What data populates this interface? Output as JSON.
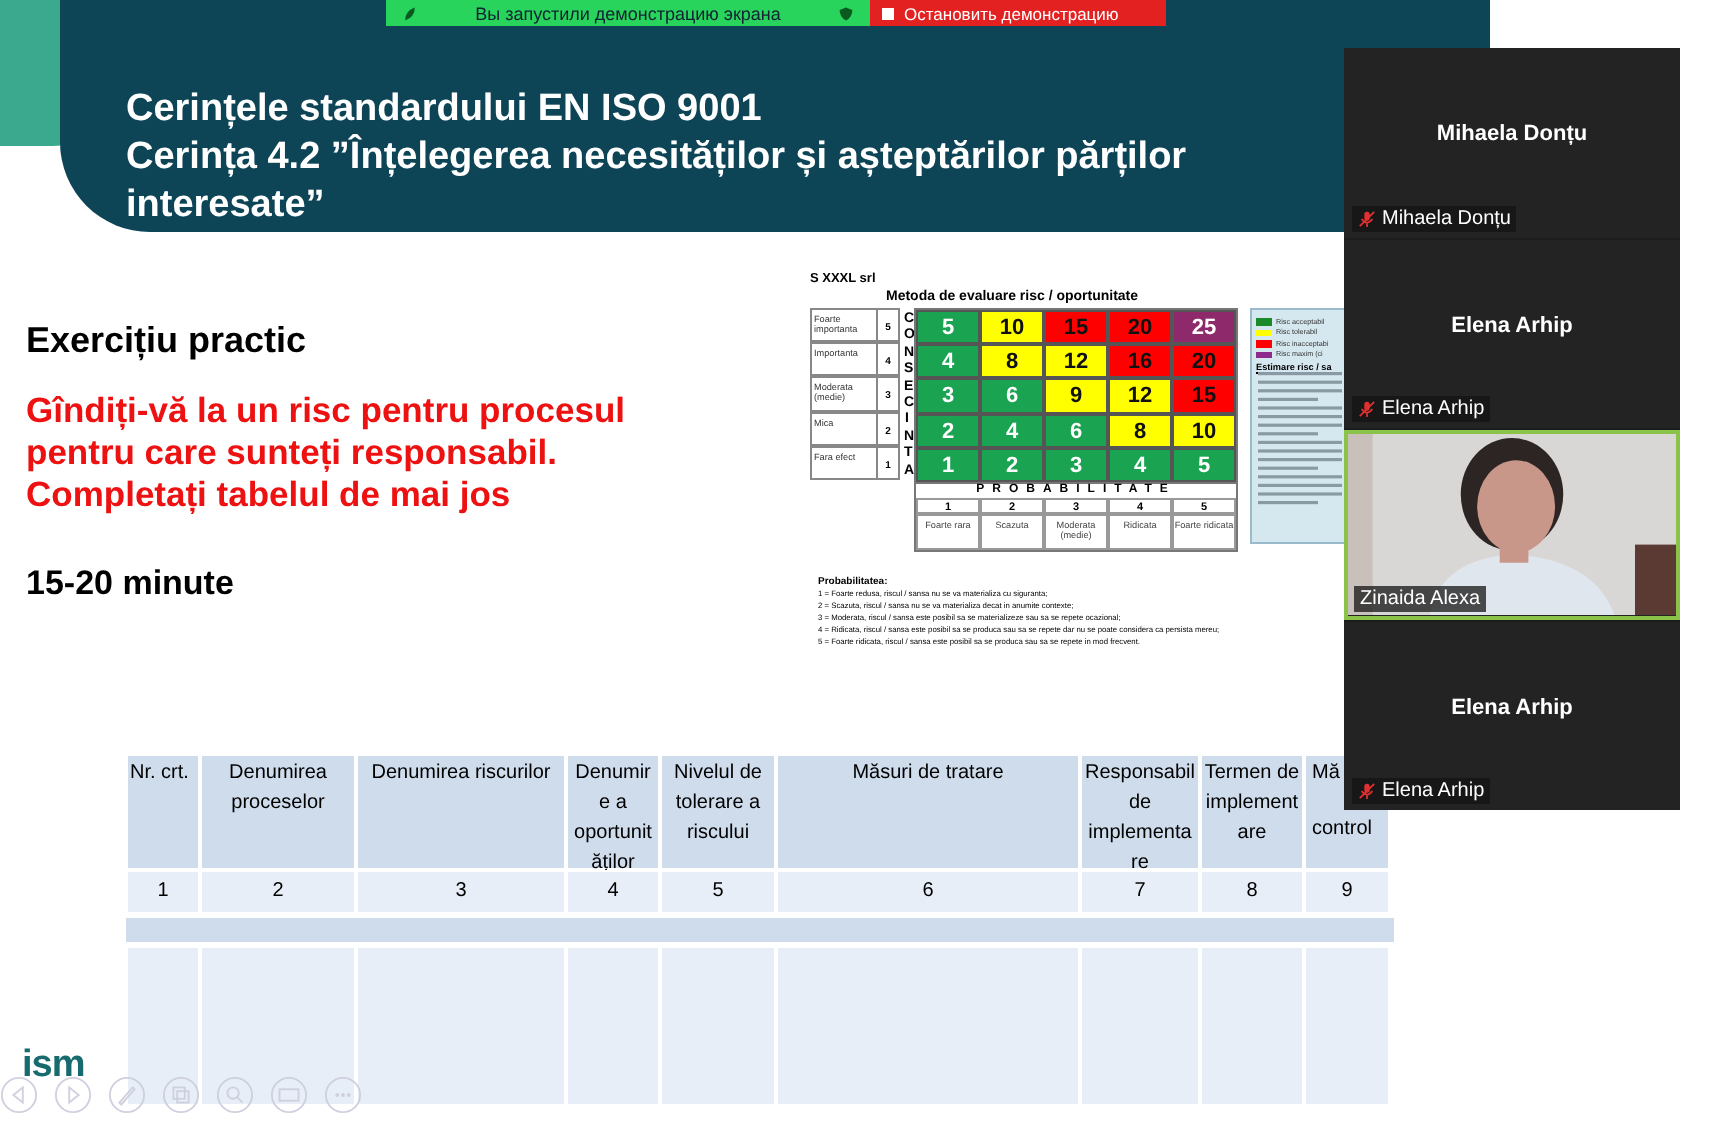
{
  "screen_share_bar": {
    "notice": "Вы запустили демонстрацию экрана",
    "stop_button": "Остановить демонстрацию"
  },
  "slide": {
    "title_lines": [
      "Cerințele standardului EN ISO 9001",
      "Cerința 4.2 ”Înțelegerea necesităților și așteptărilor părților interesate”"
    ],
    "exercise_heading": "Exercițiu practic",
    "instruction_lines": [
      "Gîndiți-vă la un risc pentru procesul",
      "pentru care sunteți responsabil.",
      "Completați tabelul de mai jos"
    ],
    "duration": "15-20 minute",
    "logo": "ism"
  },
  "risk_matrix": {
    "company": "S XXXL srl",
    "title": "Metoda de evaluare risc / oportunitate",
    "consequence_label": "CONSECINTA",
    "probability_label": "PROBABILITATE",
    "rows": [
      {
        "label": "Foarte importanta",
        "score": "5",
        "cells": [
          {
            "value": "5",
            "color": "#1aa350"
          },
          {
            "value": "10",
            "color": "#ffff00"
          },
          {
            "value": "15",
            "color": "#ff0000"
          },
          {
            "value": "20",
            "color": "#ff0000"
          },
          {
            "value": "25",
            "color": "#8e2a6b"
          }
        ]
      },
      {
        "label": "Importanta",
        "score": "4",
        "cells": [
          {
            "value": "4",
            "color": "#1aa350"
          },
          {
            "value": "8",
            "color": "#ffff00"
          },
          {
            "value": "12",
            "color": "#ffff00"
          },
          {
            "value": "16",
            "color": "#ff0000"
          },
          {
            "value": "20",
            "color": "#ff0000"
          }
        ]
      },
      {
        "label": "Moderata (medie)",
        "score": "3",
        "cells": [
          {
            "value": "3",
            "color": "#1aa350"
          },
          {
            "value": "6",
            "color": "#1aa350"
          },
          {
            "value": "9",
            "color": "#ffff00"
          },
          {
            "value": "12",
            "color": "#ffff00"
          },
          {
            "value": "15",
            "color": "#ff0000"
          }
        ]
      },
      {
        "label": "Mica",
        "score": "2",
        "cells": [
          {
            "value": "2",
            "color": "#1aa350"
          },
          {
            "value": "4",
            "color": "#1aa350"
          },
          {
            "value": "6",
            "color": "#1aa350"
          },
          {
            "value": "8",
            "color": "#ffff00"
          },
          {
            "value": "10",
            "color": "#ffff00"
          }
        ]
      },
      {
        "label": "Fara efect",
        "score": "1",
        "cells": [
          {
            "value": "1",
            "color": "#1aa350"
          },
          {
            "value": "2",
            "color": "#1aa350"
          },
          {
            "value": "3",
            "color": "#1aa350"
          },
          {
            "value": "4",
            "color": "#1aa350"
          },
          {
            "value": "5",
            "color": "#1aa350"
          }
        ]
      }
    ],
    "probability_columns": [
      {
        "score": "1",
        "label": "Foarte rara"
      },
      {
        "score": "2",
        "label": "Scazuta"
      },
      {
        "score": "3",
        "label": "Moderata (medie)"
      },
      {
        "score": "4",
        "label": "Ridicata"
      },
      {
        "score": "5",
        "label": "Foarte ridicata"
      }
    ],
    "legend": [
      {
        "label": "Risc acceptabil",
        "color": "#1a8a2a"
      },
      {
        "label": "Risc tolerabil",
        "color": "#ffff00"
      },
      {
        "label": "Risc inacceptabi",
        "color": "#ff0000"
      },
      {
        "label": "Risc maxim (ci",
        "color": "#8e2a8b"
      }
    ],
    "legend_heading": "Estimare risc / sa",
    "notes_heading": "Probabilitatea:",
    "notes": [
      "1 = Foarte redusa, riscul / sansa nu se va materializa cu siguranta;",
      "2 = Scazuta, riscul / sansa nu se va materializa decat in anumite contexte;",
      "3 = Moderata, riscul / sansa este posibil sa se materializeze sau sa se repete ocazional;",
      "4 = Ridicata, riscul / sansa este posibil sa se produca sau sa se repete dar nu se poate considera ca persista mereu;",
      "5 = Foarte ridicata, riscul / sansa este posibil sa se produca sau sa se repete in mod frecvent."
    ]
  },
  "table": {
    "columns": [
      "Nr. crt.",
      "Denumirea proceselor",
      "Denumirea riscurilor",
      "Denumire a oportunit ăților",
      "Nivelul de tolerare a riscului",
      "Măsuri de tratare",
      "Responsabil de implementa re",
      "Termen de implement are"
    ],
    "last_column_header_parts": [
      "Mă",
      "control"
    ],
    "numbers": [
      "1",
      "2",
      "3",
      "4",
      "5",
      "6",
      "7",
      "8",
      "9"
    ]
  },
  "participants": [
    {
      "name": "Mihaela Donțu",
      "label": "Mihaela Donțu",
      "kind": "avatar",
      "muted": true,
      "speaking": false
    },
    {
      "name": "Elena Arhip",
      "label": "Elena Arhip",
      "kind": "avatar",
      "muted": true,
      "speaking": false
    },
    {
      "label": "Zinaida Alexa",
      "kind": "video",
      "muted": false,
      "speaking": true
    },
    {
      "name": "Elena Arhip",
      "label": "Elena Arhip",
      "kind": "avatar",
      "muted": true,
      "speaking": false
    }
  ]
}
